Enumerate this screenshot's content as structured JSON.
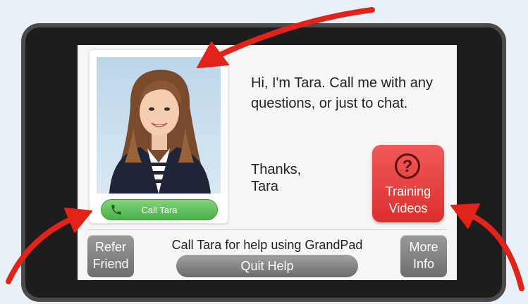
{
  "profile": {
    "message": "Hi, I'm Tara. Call me with any questions, or just to chat.",
    "sign_line1": "Thanks,",
    "sign_line2": "Tara",
    "call_label": "Call Tara"
  },
  "training_button": {
    "line1": "Training",
    "line2": "Videos",
    "icon_glyph": "?"
  },
  "footer": {
    "help_text": "Call Tara for help using GrandPad",
    "refer_line1": "Refer",
    "refer_line2": "Friend",
    "more_line1": "More",
    "more_line2": "Info",
    "quit_label": "Quit Help"
  },
  "colors": {
    "call_green": "#4cb048",
    "training_red": "#e03a3a",
    "annotation_red": "#e2231a",
    "bezel": "#1d1d1d"
  },
  "icons": [
    "phone-icon",
    "question-mark-icon",
    "annotation-arrow"
  ]
}
